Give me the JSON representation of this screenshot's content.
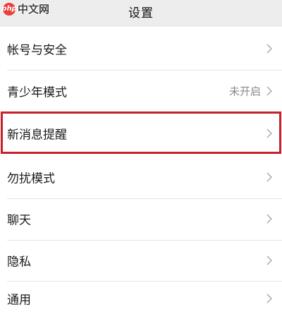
{
  "header": {
    "title": "设置"
  },
  "watermark": {
    "logo_text": "php",
    "text": "中文网"
  },
  "settings": {
    "items": [
      {
        "label": "帐号与安全",
        "value": ""
      },
      {
        "label": "青少年模式",
        "value": "未开启"
      },
      {
        "label": "新消息提醒",
        "value": ""
      },
      {
        "label": "勿扰模式",
        "value": ""
      },
      {
        "label": "聊天",
        "value": ""
      },
      {
        "label": "隐私",
        "value": ""
      },
      {
        "label": "通用",
        "value": ""
      }
    ]
  },
  "icons": {
    "row_arrow": "chevron-right-icon"
  },
  "colors": {
    "highlight_border": "#c8202a",
    "background": "#ededed",
    "value_text": "#8a8a8a"
  }
}
